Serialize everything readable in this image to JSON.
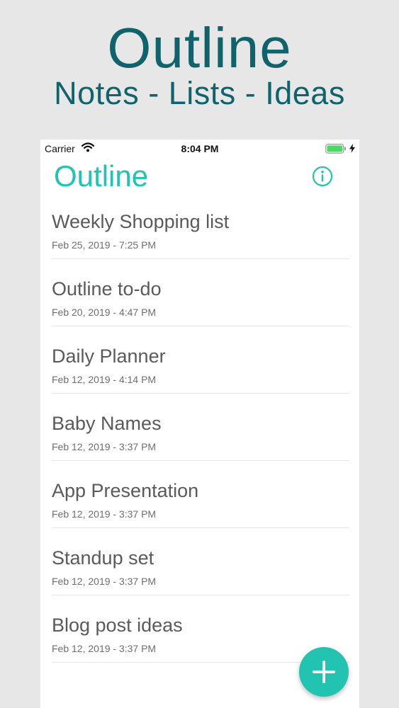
{
  "promo": {
    "title": "Outline",
    "subtitle": "Notes - Lists - Ideas"
  },
  "status_bar": {
    "carrier": "Carrier",
    "time": "8:04 PM",
    "icons": [
      "wifi-icon",
      "battery-icon",
      "charging-icon"
    ]
  },
  "header": {
    "title": "Outline",
    "info_icon": "info-icon"
  },
  "notes": [
    {
      "title": "Weekly Shopping list",
      "date": "Feb 25, 2019 - 7:25 PM"
    },
    {
      "title": "Outline to-do",
      "date": "Feb 20, 2019 - 4:47 PM"
    },
    {
      "title": "Daily Planner",
      "date": "Feb 12, 2019 - 4:14 PM"
    },
    {
      "title": "Baby Names",
      "date": "Feb 12, 2019 - 3:37 PM"
    },
    {
      "title": "App Presentation",
      "date": "Feb 12, 2019 - 3:37 PM"
    },
    {
      "title": "Standup set",
      "date": "Feb 12, 2019 - 3:37 PM"
    },
    {
      "title": "Blog post ideas",
      "date": "Feb 12, 2019 - 3:37 PM"
    }
  ],
  "fab": {
    "icon": "plus-icon"
  },
  "colors": {
    "background": "#e7e7e8",
    "promo_text": "#11636b",
    "accent": "#21c4b1",
    "note_title": "#5a5a5a",
    "note_date": "#6e6e6e",
    "battery": "#4cd964"
  }
}
